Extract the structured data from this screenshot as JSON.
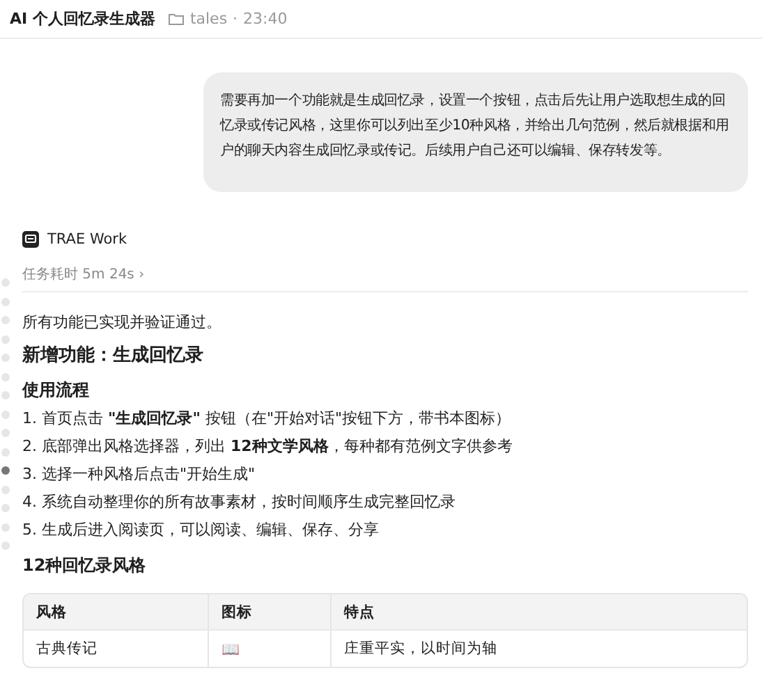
{
  "header": {
    "title": "AI 个人回忆录生成器",
    "folder": "tales",
    "separator": "·",
    "time": "23:40"
  },
  "user_message": "需要再加一个功能就是生成回忆录，设置一个按钮，点击后先让用户选取想生成的回忆录或传记风格，这里你可以列出至少10种风格，并给出几句范例，然后就根据和用户的聊天内容生成回忆录或传记。后续用户自己还可以编辑、保存转发等。",
  "agent": {
    "name": "TRAE Work",
    "duration": "任务耗时 5m 24s",
    "chevron": "›"
  },
  "timeline_dots": [
    {
      "selected": false
    },
    {
      "selected": false
    },
    {
      "selected": false
    },
    {
      "selected": false
    },
    {
      "selected": false
    },
    {
      "selected": false
    },
    {
      "selected": false
    },
    {
      "selected": false
    },
    {
      "selected": false
    },
    {
      "selected": false
    },
    {
      "selected": true
    },
    {
      "selected": false
    },
    {
      "selected": false
    },
    {
      "selected": false
    },
    {
      "selected": false
    }
  ],
  "reply": {
    "summary": "所有功能已实现并验证通过。",
    "heading": "新增功能：生成回忆录",
    "subheading": "使用流程",
    "steps": [
      "1. 首页点击 **\"生成回忆录\"** 按钮（在\"开始对话\"按钮下方，带书本图标）",
      "2. 底部弹出风格选择器，列出 **12种文学风格**，每种都有范例文字供参考",
      "3. 选择一种风格后点击\"开始生成\"",
      "4. 系统自动整理你的所有故事素材，按时间顺序生成完整回忆录",
      "5. 生成后进入阅读页，可以阅读、编辑、保存、分享"
    ],
    "table_heading": "12种回忆录风格",
    "table": {
      "columns": [
        "风格",
        "图标",
        "特点"
      ],
      "rows": [
        {
          "style": "古典传记",
          "icon": "📖",
          "feature": "庄重平实，以时间为轴"
        }
      ]
    }
  }
}
